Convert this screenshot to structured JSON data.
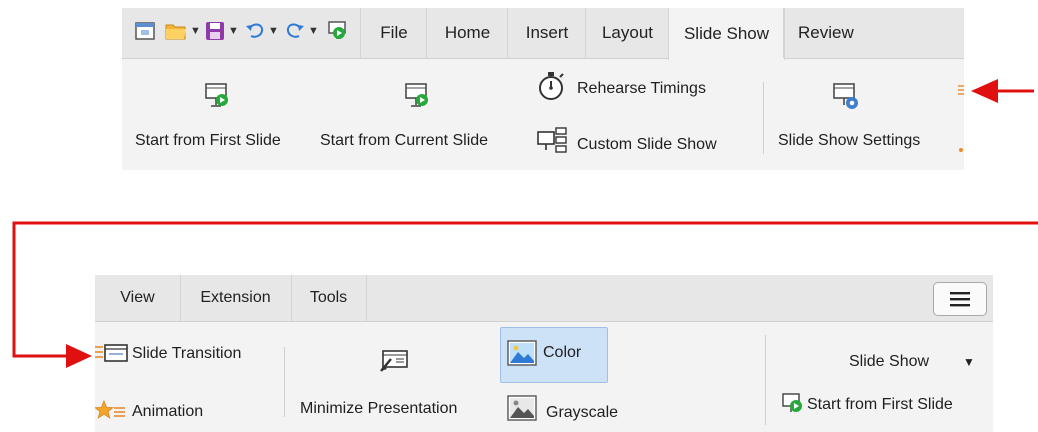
{
  "top_toolbar": {
    "tabs": [
      "File",
      "Home",
      "Insert",
      "Layout",
      "Slide Show",
      "Review"
    ],
    "buttons": {
      "start_first": "Start from First Slide",
      "start_current": "Start from Current Slide",
      "rehearse": "Rehearse Timings",
      "custom_show": "Custom Slide Show",
      "settings": "Slide Show Settings"
    }
  },
  "bottom_toolbar": {
    "tabs": [
      "View",
      "Extension",
      "Tools"
    ],
    "buttons": {
      "slide_transition": "Slide Transition",
      "animation": "Animation",
      "minimize": "Minimize Presentation",
      "color": "Color",
      "grayscale": "Grayscale",
      "slide_show_dropdown": "Slide Show",
      "start_first": "Start from First Slide"
    }
  },
  "colors": {
    "arrow": "#e01010",
    "active_button": "#cde1f7",
    "panel": "#f3f3f3"
  }
}
